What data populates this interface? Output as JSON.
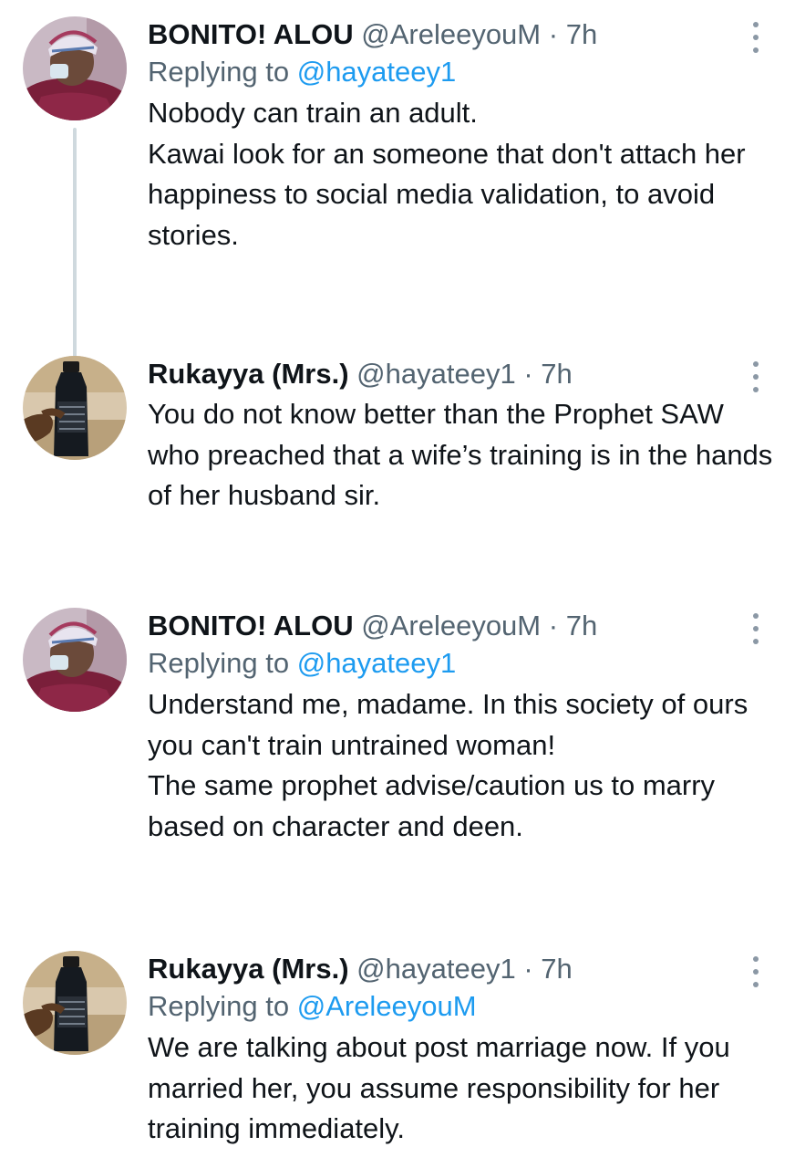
{
  "theme": {
    "text": "#0f1419",
    "secondary_text": "#536471",
    "link": "#1d9bf0",
    "thread_line": "#cfd9de"
  },
  "tweets": [
    {
      "name": "BONITO! ALOU",
      "handle": "@AreleeyouM",
      "separator": "·",
      "time": "7h",
      "replying_prefix": "Replying to",
      "replying_to": "@hayateey1",
      "text": "Nobody can train an adult.\nKawai look for an someone that don't attach her happiness to social media validation, to avoid stories.",
      "avatar_icon": "avatar-man-cap-mask-icon",
      "more_icon": "more-vertical-icon"
    },
    {
      "name": "Rukayya (Mrs.)",
      "handle": "@hayateey1",
      "separator": "·",
      "time": "7h",
      "text": "You do not know better than the Prophet SAW who preached that a wife’s training is in the hands of her husband sir.",
      "avatar_icon": "avatar-bottle-hand-icon",
      "more_icon": "more-vertical-icon"
    },
    {
      "name": "BONITO! ALOU",
      "handle": "@AreleeyouM",
      "separator": "·",
      "time": "7h",
      "replying_prefix": "Replying to",
      "replying_to": "@hayateey1",
      "text": "Understand me, madame. In this society of ours you can't train untrained woman!\n The same prophet advise/caution us to marry based on character and deen.",
      "avatar_icon": "avatar-man-cap-mask-icon",
      "more_icon": "more-vertical-icon"
    },
    {
      "name": "Rukayya (Mrs.)",
      "handle": "@hayateey1",
      "separator": "·",
      "time": "7h",
      "replying_prefix": "Replying to",
      "replying_to": "@AreleeyouM",
      "text": "We are talking about post marriage now. If you married her, you assume responsibility for her training immediately.",
      "avatar_icon": "avatar-bottle-hand-icon",
      "more_icon": "more-vertical-icon"
    }
  ]
}
